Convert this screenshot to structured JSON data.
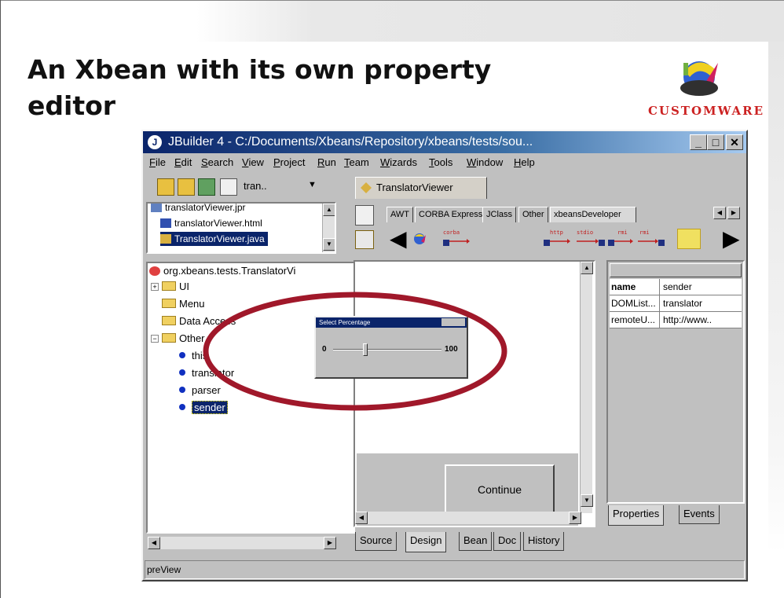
{
  "slide": {
    "title": "An Xbean with its own property\neditor",
    "logo_text": "CUSTOMWARE"
  },
  "window": {
    "title": "JBuilder 4 - C:/Documents/Xbeans/Repository/xbeans/tests/sou...",
    "menu": [
      "File",
      "Edit",
      "Search",
      "View",
      "Project",
      "Run",
      "Team",
      "Wizards",
      "Tools",
      "Window",
      "Help"
    ],
    "project_combo": "tran..",
    "file_tab": "TranslatorViewer",
    "project_files": [
      "translatorViewer.jpr",
      "translatorViewer.html",
      "TranslatorViewer.java"
    ],
    "tree": {
      "root": "org.xbeans.tests.TranslatorVi",
      "folders": [
        "UI",
        "Menu",
        "Data Access",
        "Other"
      ],
      "children": [
        "this",
        "translator",
        "parser",
        "sender"
      ]
    },
    "palette_tabs": [
      "AWT",
      "CORBA Express",
      "JClass",
      "Other",
      "xbeansDeveloper"
    ],
    "palette_labels": {
      "corba": "corba",
      "http": "http",
      "stdio": "stdio",
      "rmi1": "rmi",
      "rmi2": "rmi"
    },
    "design": {
      "continue_label": "Continue"
    },
    "properties": {
      "rows": [
        {
          "key": "name",
          "value": "sender"
        },
        {
          "key": "DOMList...",
          "value": "translator"
        },
        {
          "key": "remoteU...",
          "value": "http://www.."
        }
      ],
      "tabs": [
        "Properties",
        "Events"
      ]
    },
    "bottom_tabs": [
      "Source",
      "Design",
      "Bean",
      "Doc",
      "History"
    ],
    "status": "preView"
  },
  "dialog": {
    "title": "Select Percentage",
    "min": "0",
    "max": "100",
    "value_percent": 30
  },
  "colors": {
    "title_bar": "#0a246a",
    "highlight_ellipse": "#a0182a",
    "logo_text": "#cc2222"
  }
}
